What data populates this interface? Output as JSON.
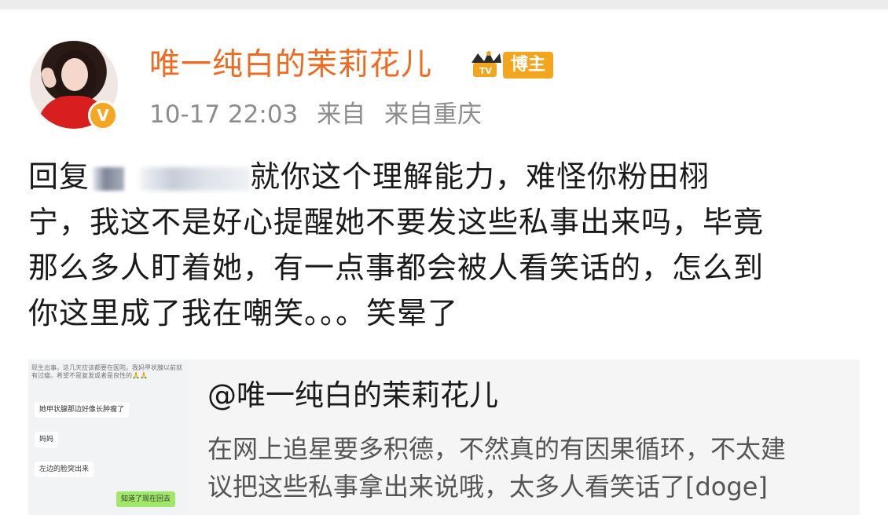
{
  "post": {
    "author": "唯一纯白的茉莉花儿",
    "author_badge": "博主",
    "time": "10-17 22:03",
    "source_prefix": "来自",
    "source": "来自重庆",
    "text_lines": [
      "回复",
      "就你这个理解能力，难怪你粉田栩",
      "宁，我这不是好心提醒她不要发这些私事出来吗，毕竟",
      "那么多人盯着她，有一点事都会被人看笑话的，怎么到",
      "你这里成了我在嘲笑。。。笑晕了"
    ]
  },
  "quoted": {
    "author": "@唯一纯白的茉莉花儿",
    "text_lines": [
      "在网上追星要多积德，不然真的有因果循环，不太建",
      "议把这些私事拿出来说哦，太多人看笑话了[doge]"
    ],
    "thumbnail": {
      "header": "现生出事。这几天应该都要在医院。我妈甲状腺以前就有过瘤。希望不是复发或者是良性的🙏🙏",
      "bubbles": [
        "她甲状腺那边好像长肿瘤了",
        "妈妈",
        "左边的脸突出来",
        "知道了现在回去"
      ]
    }
  },
  "colors": {
    "username": "#ef6a1f",
    "badge": "#f3a51e",
    "meta": "#8c8c8c",
    "card_bg": "#f5f5f5"
  },
  "icons": [
    "verified-v-icon",
    "tv-crown-icon"
  ]
}
